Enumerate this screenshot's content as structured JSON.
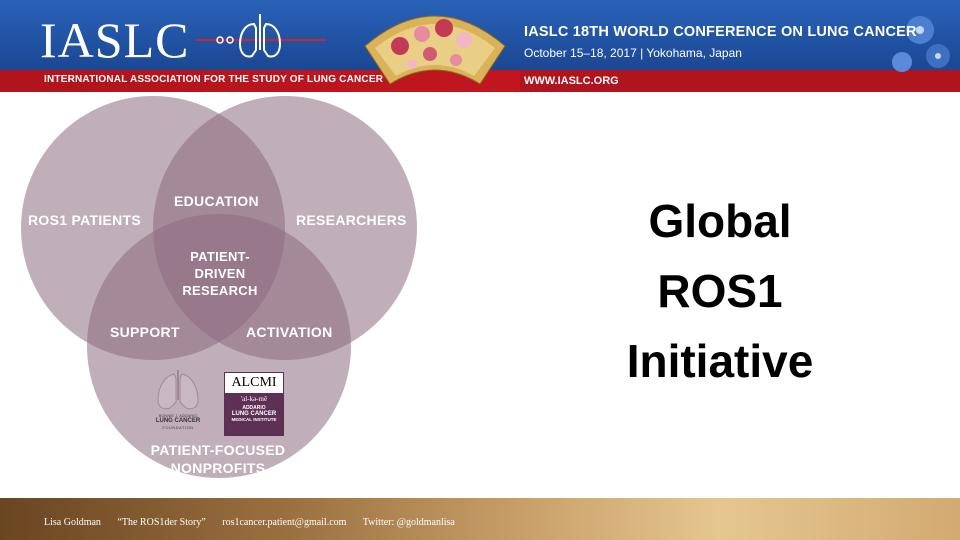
{
  "header": {
    "logo_text": "IASLC",
    "association": "INTERNATIONAL ASSOCIATION FOR THE STUDY OF LUNG CANCER",
    "conference_title": "IASLC 18TH WORLD CONFERENCE ON LUNG CANCER",
    "conference_date": "October 15–18, 2017 | Yokohama, Japan",
    "website": "WWW.IASLC.ORG"
  },
  "venn": {
    "ros1_patients": "ROS1 PATIENTS",
    "researchers": "RESEARCHERS",
    "nonprofits_l1": "PATIENT-FOCUSED",
    "nonprofits_l2": "NONPROFITS",
    "education": "EDUCATION",
    "support": "SUPPORT",
    "activation": "ACTIVATION",
    "center_l1": "PATIENT-",
    "center_l2": "DRIVEN",
    "center_l3": "RESEARCH",
    "circle_color": "#8c6c80"
  },
  "logos": {
    "lcf_line1": "BONNIE J. ADDARIO",
    "lcf_line2": "LUNG CANCER",
    "lcf_line3": "FOUNDATION",
    "alcmi_name": "ALCMI",
    "alcmi_pron": "'al-kə-mē",
    "alcmi_sub1": "ADDARIO",
    "alcmi_sub2": "LUNG CANCER",
    "alcmi_sub3": "MEDICAL INSTITUTE"
  },
  "title": {
    "line1": "Global",
    "line2": "ROS1",
    "line3": "Initiative"
  },
  "footer": {
    "author": "Lisa Goldman",
    "talk": "“The ROS1der Story”",
    "email": "ros1cancer.patient@gmail.com",
    "twitter": "Twitter:  @goldmanlisa"
  }
}
